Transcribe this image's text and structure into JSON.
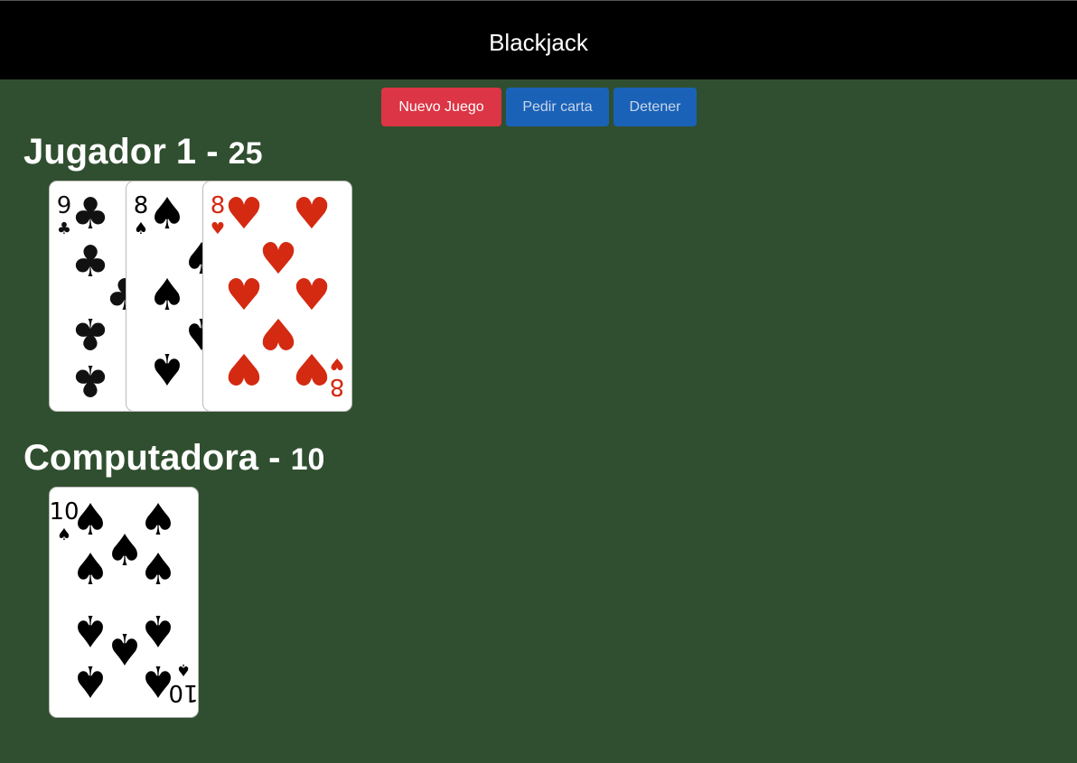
{
  "app": {
    "title": "Blackjack"
  },
  "controls": {
    "new_game_label": "Nuevo Juego",
    "hit_label": "Pedir carta",
    "stand_label": "Detener"
  },
  "player": {
    "name": "Jugador 1",
    "separator": "-",
    "score": "25",
    "cards": [
      {
        "rank": "9",
        "suit": "clubs",
        "color": "#111111"
      },
      {
        "rank": "8",
        "suit": "spades",
        "color": "#000000"
      },
      {
        "rank": "8",
        "suit": "hearts",
        "color": "#d42a12"
      }
    ]
  },
  "computer": {
    "name": "Computadora",
    "separator": "-",
    "score": "10",
    "cards": [
      {
        "rank": "10",
        "suit": "spades",
        "color": "#000000"
      }
    ]
  },
  "colors": {
    "table_green": "#304f30",
    "header_black": "#000000",
    "danger_red": "#dc3545",
    "primary_blue": "#1a62b8"
  }
}
